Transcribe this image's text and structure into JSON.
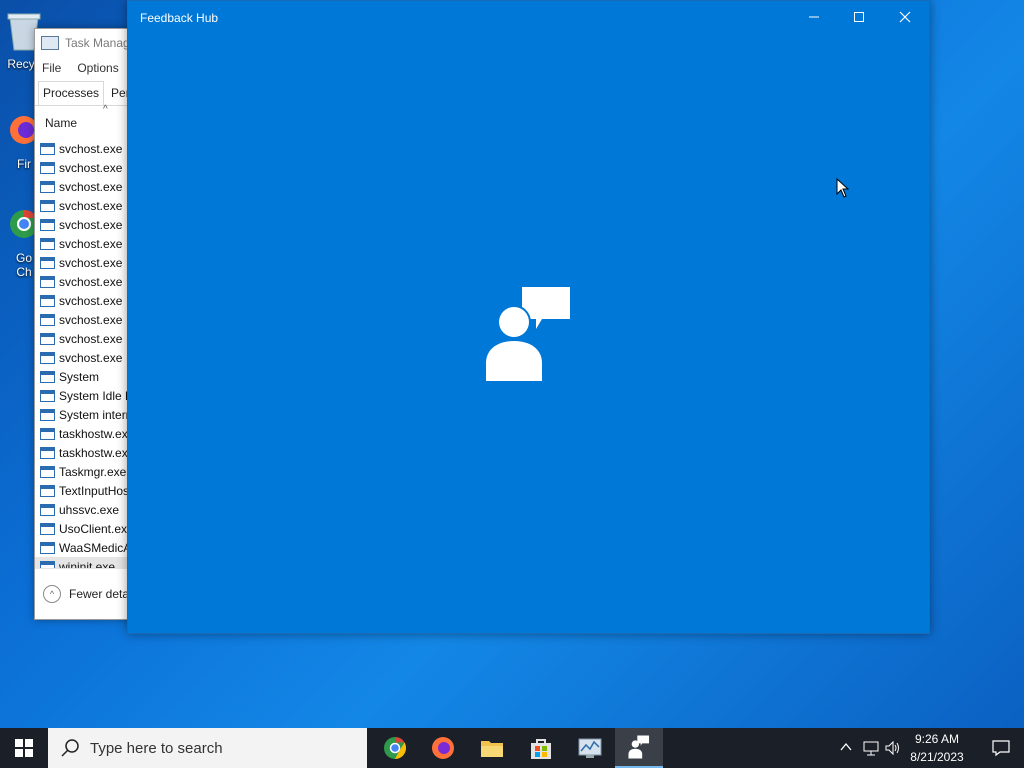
{
  "desktop": {
    "icons": [
      {
        "name": "recycle-bin",
        "label": "Recyc"
      },
      {
        "name": "firefox",
        "label": "Fir"
      },
      {
        "name": "chrome",
        "label": "Go\nCh"
      }
    ]
  },
  "task_manager": {
    "title": "Task Manag",
    "menu": [
      "File",
      "Options"
    ],
    "tabs": [
      "Processes",
      "Perfo"
    ],
    "column_name": "Name",
    "processes": [
      "svchost.exe",
      "svchost.exe",
      "svchost.exe",
      "svchost.exe",
      "svchost.exe",
      "svchost.exe",
      "svchost.exe",
      "svchost.exe",
      "svchost.exe",
      "svchost.exe",
      "svchost.exe",
      "svchost.exe",
      "System",
      "System Idle P",
      "System interr",
      "taskhostw.exe",
      "taskhostw.exe",
      "Taskmgr.exe",
      "TextInputHos",
      "uhssvc.exe",
      "UsoClient.exe",
      "WaaSMedicA",
      "wininit.exe"
    ],
    "fewer_details": "Fewer detai"
  },
  "feedback_hub": {
    "title": "Feedback Hub"
  },
  "taskbar": {
    "search_placeholder": "Type here to search",
    "time": "9:26 AM",
    "date": "8/21/2023"
  },
  "colors": {
    "feedback_blue": "#0078d7",
    "taskbar_bg": "#1b1f27"
  }
}
